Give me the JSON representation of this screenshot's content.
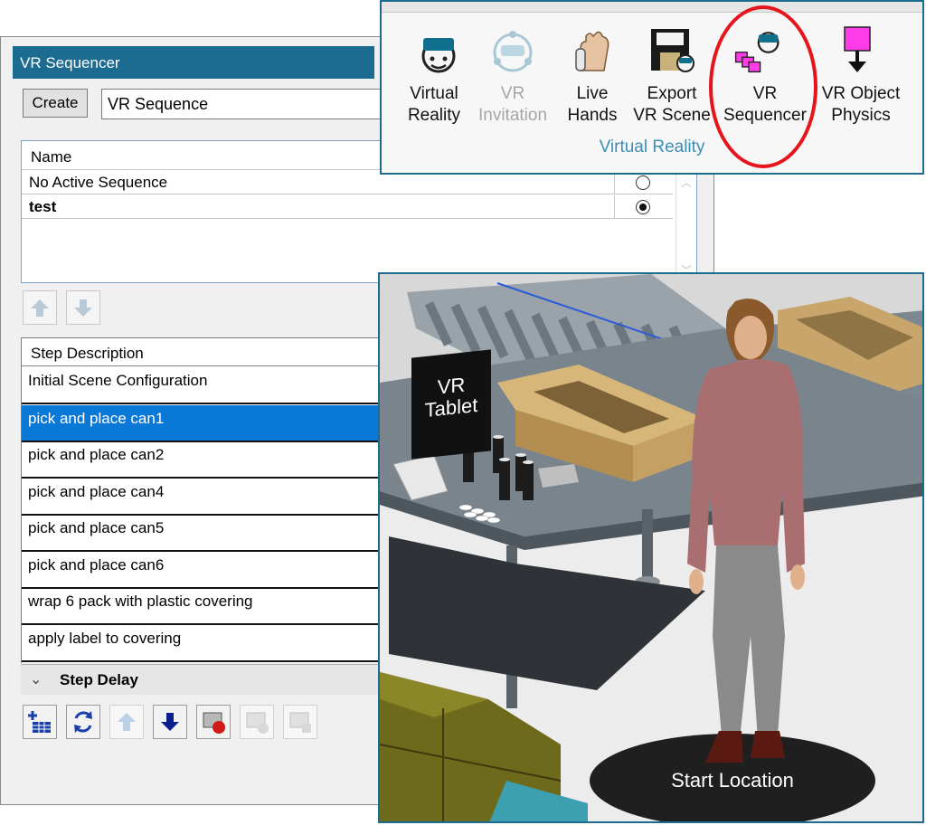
{
  "vr_sequencer": {
    "title": "VR Sequencer",
    "create_label": "Create",
    "name_value": "VR Sequence",
    "sequence_table": {
      "column_name": "Name",
      "rows": [
        {
          "name": "No Active Sequence",
          "active": false
        },
        {
          "name": "test",
          "active": true
        }
      ]
    },
    "step_description_header": "Step Description",
    "steps": [
      "Initial Scene Configuration",
      "pick and place can1",
      "pick and place can2",
      "pick and place can4",
      "pick and place can5",
      "pick and place can6",
      "wrap 6 pack with plastic covering",
      "apply label to covering"
    ],
    "selected_step": "pick and place can1",
    "step_delay_label": "Step Delay",
    "toolbar_icons": [
      "add-step-icon",
      "refresh-icon",
      "move-up-icon",
      "move-down-icon",
      "record-icon",
      "edit-disabled-icon",
      "delete-disabled-icon"
    ]
  },
  "ribbon": {
    "group_label": "Virtual Reality",
    "buttons": [
      {
        "line1": "Virtual",
        "line2": "Reality",
        "icon": "vr-headset-icon",
        "enabled": true
      },
      {
        "line1": "VR",
        "line2": "Invitation",
        "icon": "vr-invitation-icon",
        "enabled": false
      },
      {
        "line1": "Live",
        "line2": "Hands",
        "icon": "live-hands-icon",
        "enabled": true
      },
      {
        "line1": "Export",
        "line2": "VR Scene",
        "icon": "export-vr-scene-icon",
        "enabled": true
      },
      {
        "line1": "VR",
        "line2": "Sequencer",
        "icon": "vr-sequencer-icon",
        "enabled": true,
        "highlighted": true
      },
      {
        "line1": "VR Object",
        "line2": "Physics",
        "icon": "vr-object-physics-icon",
        "enabled": true
      }
    ],
    "highlight_color": "#e8141c"
  },
  "scene": {
    "tablet_label_line1": "VR",
    "tablet_label_line2": "Tablet",
    "start_location_label": "Start Location"
  },
  "colors": {
    "selection": "#0a78d7",
    "title_bar": "#1c6b90",
    "group_label": "#3b8fb5"
  }
}
